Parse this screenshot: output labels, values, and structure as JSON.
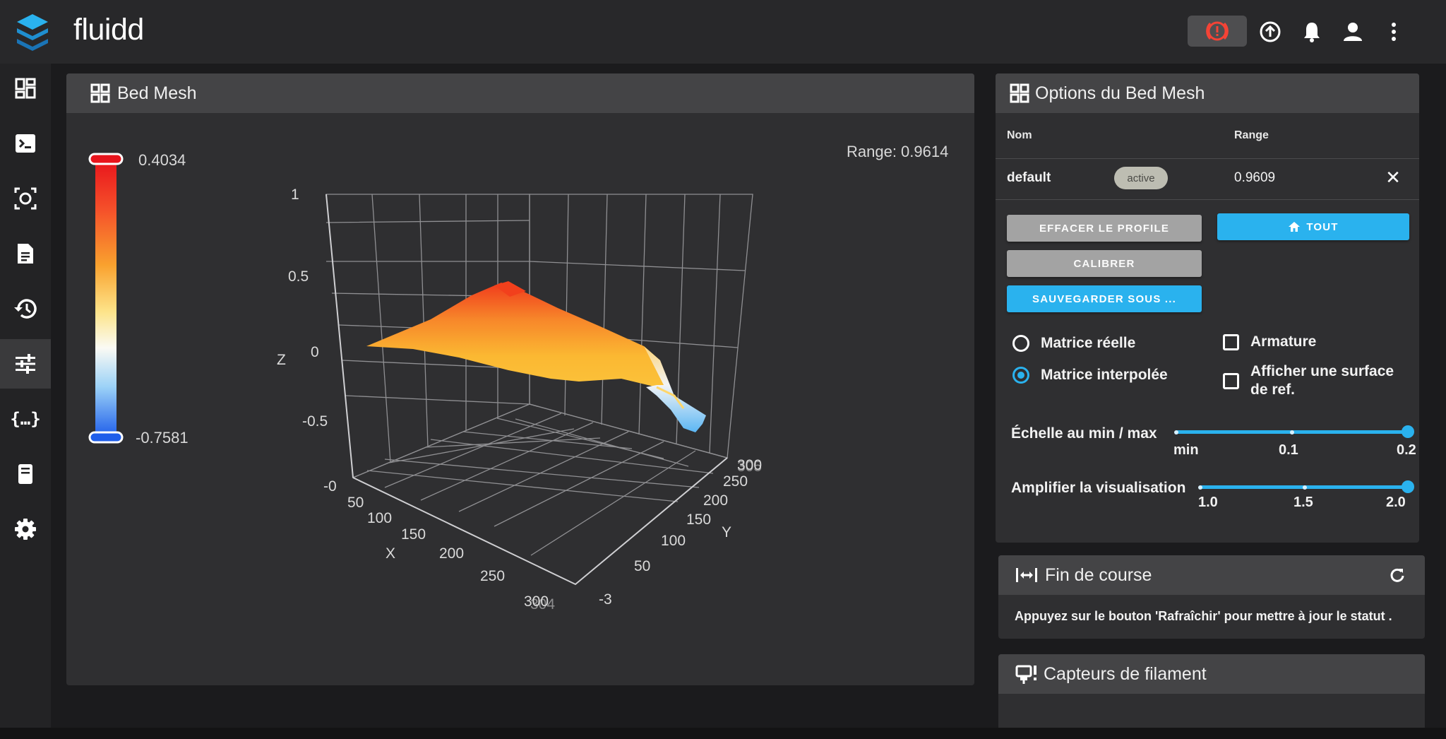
{
  "app": {
    "title": "fluidd",
    "logo_icon": "layers-icon",
    "top_icons": [
      "emergency-stop-icon",
      "upload-icon",
      "bell-icon",
      "account-icon",
      "more-vert-icon"
    ],
    "accent": "#2ab2ee",
    "danger": "#f44336"
  },
  "sidebar": {
    "items": [
      {
        "icon": "dashboard-icon"
      },
      {
        "icon": "console-icon"
      },
      {
        "icon": "webcam-icon"
      },
      {
        "icon": "file-icon"
      },
      {
        "icon": "history-icon"
      },
      {
        "icon": "tune-icon",
        "active": true
      },
      {
        "icon": "code-braces-icon"
      },
      {
        "icon": "sd-card-icon"
      },
      {
        "icon": "settings-icon"
      }
    ]
  },
  "bed_mesh": {
    "title": "Bed Mesh",
    "color_max": "0.4034",
    "color_min": "-0.7581",
    "range_text": "Range: 0.9614",
    "z_axis_label": "Z",
    "x_axis_label": "X",
    "y_axis_label": "Y",
    "z_ticks": [
      "1",
      "0.5",
      "0",
      "-0.5"
    ],
    "x_ticks": [
      "-0",
      "50",
      "100",
      "150",
      "200",
      "250",
      "300",
      "304"
    ],
    "y_ticks": [
      "-3",
      "50",
      "100",
      "150",
      "200",
      "250",
      "300",
      "305"
    ]
  },
  "options": {
    "title": "Options du Bed Mesh",
    "col_name": "Nom",
    "col_range": "Range",
    "profile_name": "default",
    "profile_status": "active",
    "profile_range": "0.9609",
    "btn_clear": "EFFACER LE PROFILE",
    "btn_home": "TOUT",
    "btn_calibrate": "CALIBRER",
    "btn_save_as": "SAUVEGARDER SOUS ...",
    "radio_real": "Matrice réelle",
    "radio_interp": "Matrice interpolée",
    "radio_selected": "interp",
    "check_wireframe": "Armature",
    "check_ref_surface": "Afficher une surface de ref.",
    "scale_label": "Échelle au min / max",
    "scale_ticks": [
      "min",
      "0.1",
      "0.2"
    ],
    "scale_value": 0.2,
    "amplify_label": "Amplifier la visualisation",
    "amplify_ticks": [
      "1.0",
      "1.5",
      "2.0"
    ],
    "amplify_value": 2.0
  },
  "endstops": {
    "title": "Fin de course",
    "message": "Appuyez sur le bouton 'Rafraîchir' pour mettre à jour le statut ."
  },
  "filament": {
    "title": "Capteurs de filament"
  }
}
